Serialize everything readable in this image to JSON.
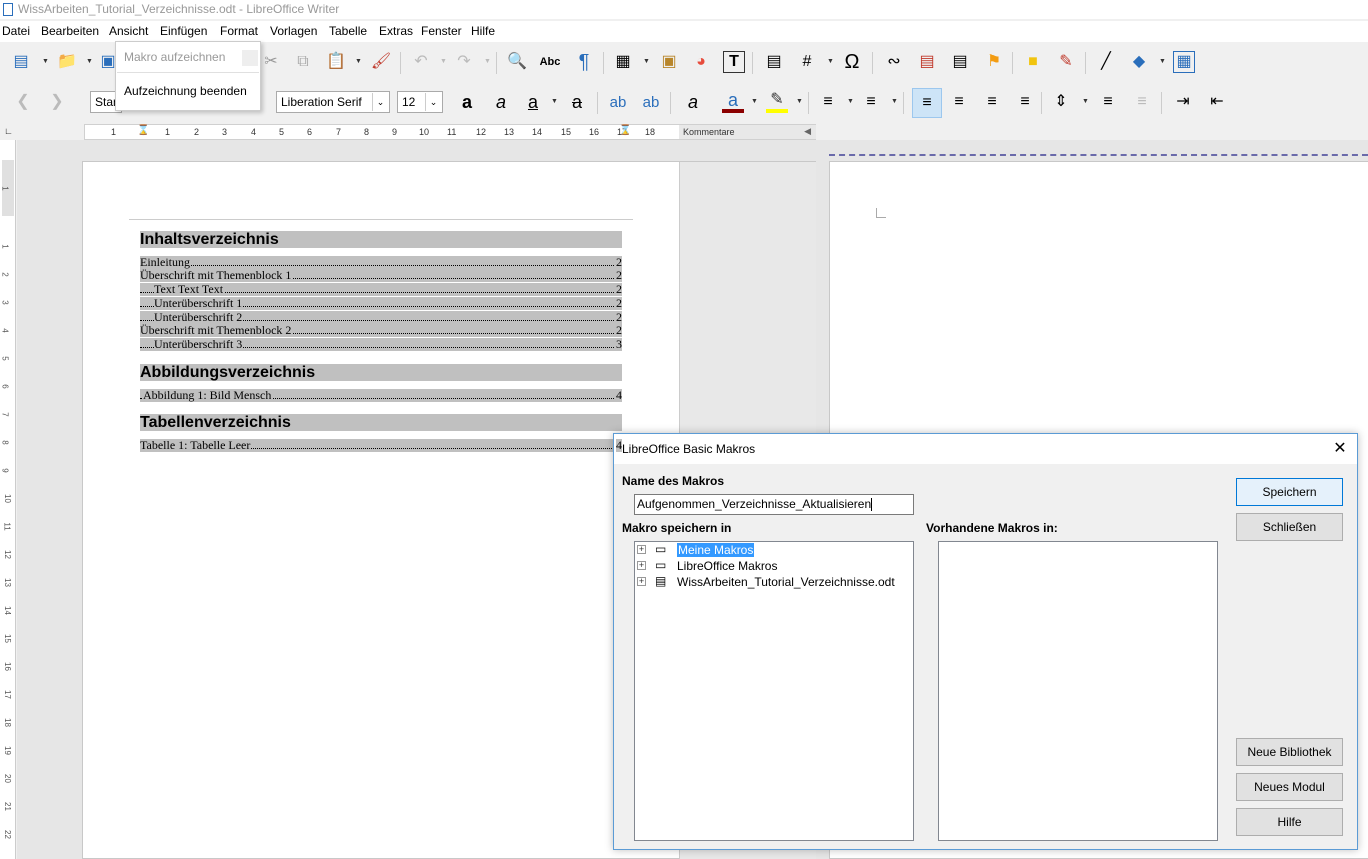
{
  "window": {
    "title": "WissArbeiten_Tutorial_Verzeichnisse.odt - LibreOffice Writer"
  },
  "menubar": {
    "items": [
      "Datei",
      "Bearbeiten",
      "Ansicht",
      "Einfügen",
      "Format",
      "Vorlagen",
      "Tabelle",
      "Extras",
      "Fenster",
      "Hilfe"
    ]
  },
  "popup": {
    "items": [
      "Makro aufzeichnen",
      "Aufzeichnung beenden"
    ]
  },
  "formatting": {
    "style_value": "Stan",
    "font_name": "Liberation Serif",
    "font_size": "12"
  },
  "ruler": {
    "numbers": [
      "1",
      "1",
      "2",
      "3",
      "4",
      "5",
      "6",
      "7",
      "8",
      "9",
      "10",
      "11",
      "12",
      "13",
      "14",
      "15",
      "16",
      "17",
      "18"
    ],
    "comments_label": "Kommentare"
  },
  "vruler": {
    "numbers": [
      "1",
      "1",
      "2",
      "3",
      "4",
      "5",
      "6",
      "7",
      "8",
      "9",
      "10",
      "11",
      "12",
      "13",
      "14",
      "15",
      "16",
      "17",
      "18",
      "19",
      "20",
      "21",
      "22"
    ]
  },
  "document": {
    "toc_title": "Inhaltsverzeichnis",
    "toc_entries": [
      {
        "text": "Einleitung",
        "page": "2"
      },
      {
        "text": "Überschrift mit Themenblock 1",
        "page": "2"
      },
      {
        "text": "Text Text Text",
        "page": "2"
      },
      {
        "text": "Unterüberschrift 1",
        "page": "2"
      },
      {
        "text": "Unterüberschrift 2",
        "page": "2"
      },
      {
        "text": "Überschrift mit Themenblock 2",
        "page": "2"
      },
      {
        "text": "Unterüberschrift 3",
        "page": "3"
      }
    ],
    "fig_title": "Abbildungsverzeichnis",
    "fig_entries": [
      {
        "text": "Abbildung 1: Bild Mensch",
        "page": "4"
      }
    ],
    "tab_title": "Tabellenverzeichnis",
    "tab_entries": [
      {
        "text": "Tabelle 1: Tabelle Leer",
        "page": "4"
      }
    ]
  },
  "dialog": {
    "title": "LibreOffice Basic Makros",
    "name_label": "Name des Makros",
    "name_value": "Aufgenommen_Verzeichnisse_Aktualisieren",
    "save_in_label": "Makro speichern in",
    "existing_label": "Vorhandene Makros in:",
    "tree": [
      "Meine Makros",
      "LibreOffice Makros",
      "WissArbeiten_Tutorial_Verzeichnisse.odt"
    ],
    "buttons": {
      "save": "Speichern",
      "close": "Schließen",
      "new_library": "Neue Bibliothek",
      "new_module": "Neues Modul",
      "help": "Hilfe"
    }
  }
}
